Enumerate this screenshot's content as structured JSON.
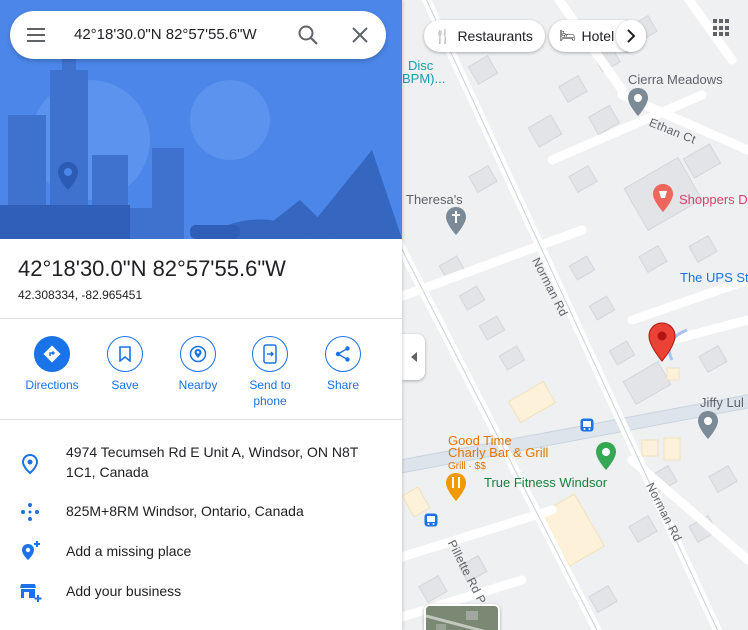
{
  "search": {
    "query": "42°18'30.0\"N 82°57'55.6\"W"
  },
  "place": {
    "title": "42°18'30.0\"N 82°57'55.6\"W",
    "coords": "42.308334, -82.965451"
  },
  "actions": [
    {
      "label": "Directions"
    },
    {
      "label": "Save"
    },
    {
      "label": "Nearby"
    },
    {
      "label": "Send to phone"
    },
    {
      "label": "Share"
    }
  ],
  "details": {
    "address": "4974 Tecumseh Rd E Unit A, Windsor, ON N8T 1C1, Canada",
    "plus_code": "825M+8RM Windsor, Ontario, Canada",
    "missing_place": "Add a missing place",
    "business": "Add your business"
  },
  "map": {
    "chips": [
      "Restaurants",
      "Hotel"
    ],
    "labels": {
      "disc": "Disc",
      "bpm": "BPM)...",
      "cierra": "Cierra Meadows",
      "ethan": "Ethan Ct",
      "theresa": "Theresa's",
      "shoppers": "Shoppers D",
      "ups": "The UPS St",
      "jiffy": "Jiffy Lul",
      "goodtime1": "Good Time",
      "goodtime2": "Charly Bar & Grill",
      "goodtime3": "Grill · $$",
      "fitness": "True Fitness Windsor",
      "norman1": "Norman Rd",
      "norman2": "Norman Rd",
      "pillette": "Pillette Rd P"
    },
    "colors": {
      "pin": "#ea4335",
      "accent": "#1a73e8"
    }
  }
}
